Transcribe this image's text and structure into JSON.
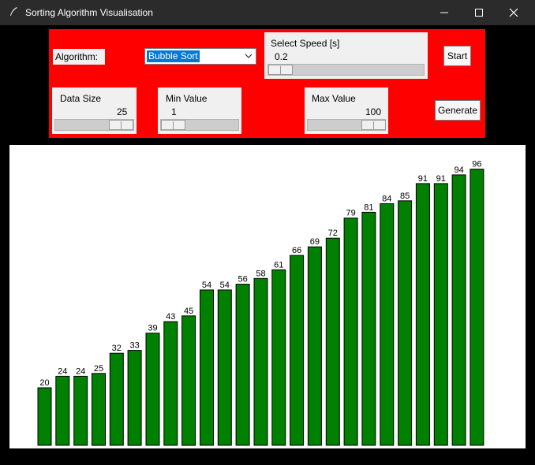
{
  "window": {
    "title": "Sorting Algorithm Visualisation",
    "minimize_icon": "minimize-icon",
    "maximize_icon": "maximize-icon",
    "close_icon": "close-icon"
  },
  "controls": {
    "algorithm_label": "Algorithm:",
    "algorithm_selected": "Bubble Sort",
    "speed_label": "Select Speed [s]",
    "speed_value": "0.2",
    "start_label": "Start",
    "data_size_label": "Data Size",
    "data_size_value": "25",
    "min_value_label": "Min Value",
    "min_value_value": "1",
    "max_value_label": "Max Value",
    "max_value_value": "100",
    "generate_label": "Generate"
  },
  "colors": {
    "panel_bg": "#ff0000",
    "bar_fill": "#008000",
    "window_bg": "#000000"
  },
  "chart_data": {
    "type": "bar",
    "values": [
      20,
      24,
      24,
      25,
      32,
      33,
      39,
      43,
      45,
      54,
      54,
      56,
      58,
      61,
      66,
      69,
      72,
      79,
      81,
      84,
      85,
      91,
      91,
      94,
      96
    ]
  }
}
